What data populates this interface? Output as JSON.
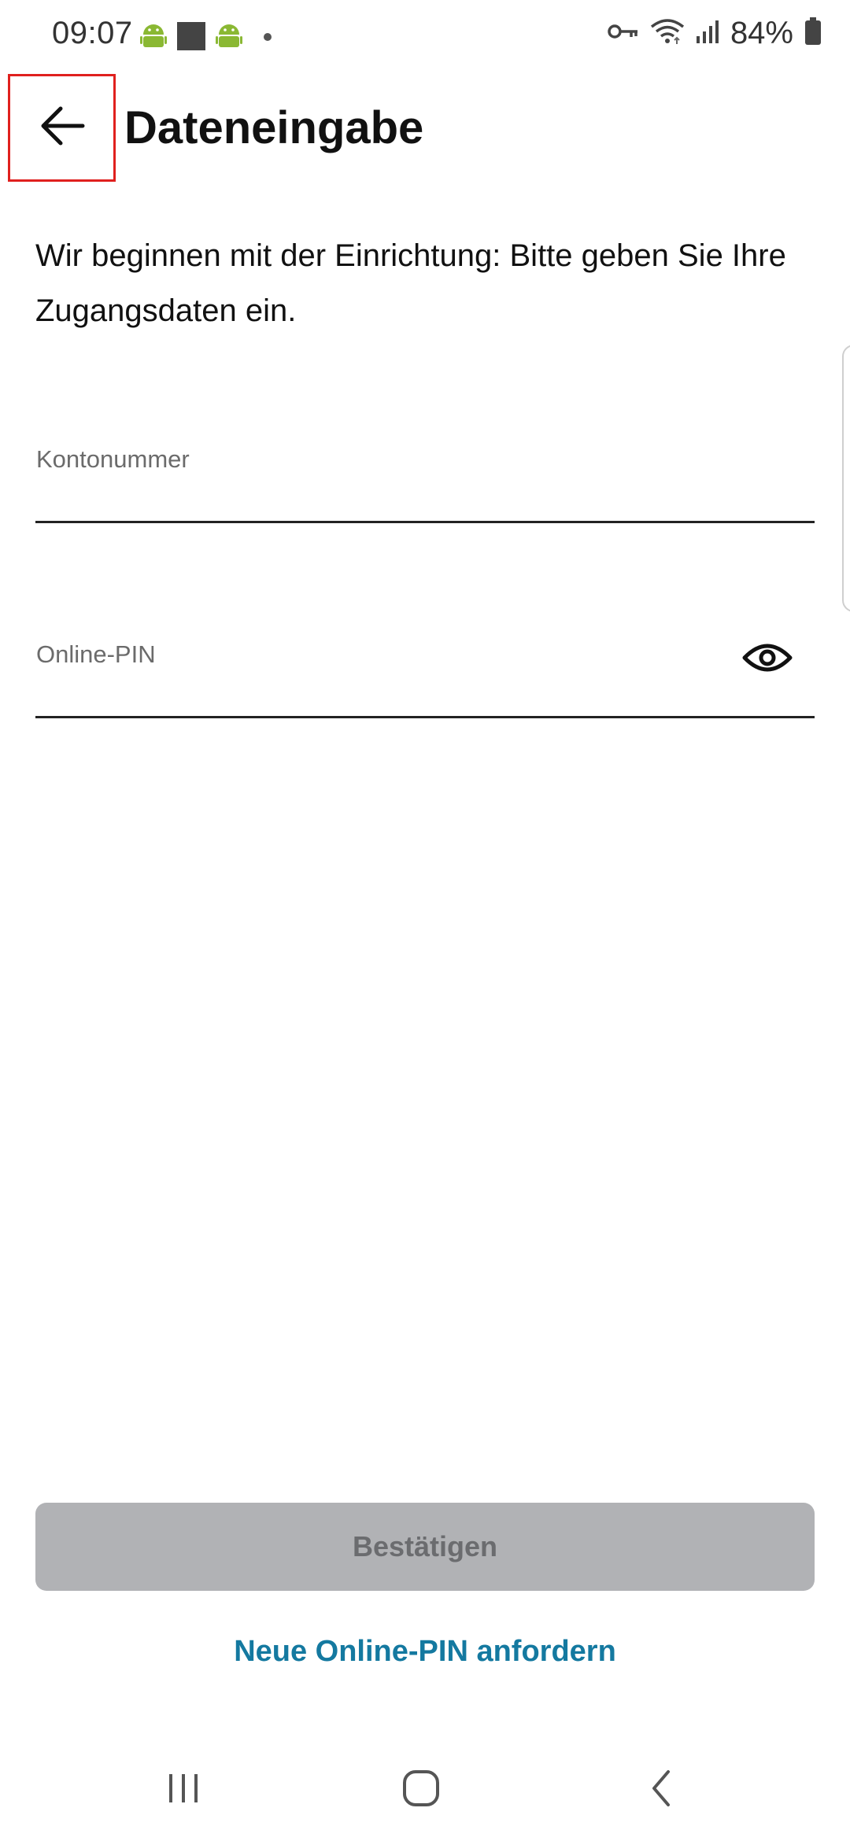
{
  "status_bar": {
    "time": "09:07",
    "battery": "84%",
    "left_icons": [
      "android-icon",
      "square-icon",
      "android-icon",
      "dot-icon"
    ],
    "right_icons": [
      "key-icon",
      "wifi-icon",
      "signal-icon",
      "battery-icon"
    ]
  },
  "header": {
    "title": "Dateneingabe",
    "back_icon": "arrow-left-icon"
  },
  "intro": {
    "text": "Wir beginnen mit der Einrichtung: Bitte geben Sie Ihre Zugangsdaten ein."
  },
  "form": {
    "account_label": "Kontonummer",
    "account_value": "",
    "pin_label": "Online-PIN",
    "pin_value": "",
    "pin_visibility_icon": "eye-icon"
  },
  "actions": {
    "confirm_label": "Bestätigen",
    "confirm_enabled": false,
    "new_pin_label": "Neue Online-PIN anfordern"
  },
  "colors": {
    "accent_link": "#1479a0",
    "button_disabled_bg": "#b1b2b5",
    "button_disabled_text": "#6b6c6f",
    "highlight_border": "#e0201e",
    "android_green": "#8ab833"
  },
  "nav_bar": {
    "icons": [
      "recent-apps-icon",
      "home-icon",
      "back-icon"
    ]
  }
}
